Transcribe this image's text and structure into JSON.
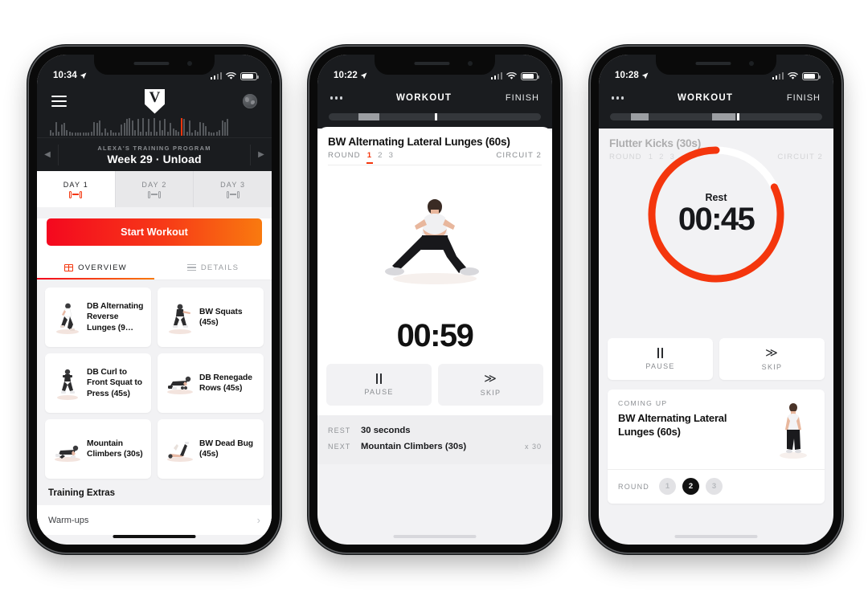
{
  "phone1": {
    "status": {
      "time": "10:34",
      "location_icon": "location-arrow-icon",
      "signal": "signal-icon",
      "wifi": "wifi-icon",
      "battery": "battery-icon"
    },
    "nav": {
      "menu_icon": "hamburger-menu-icon",
      "logo": "V",
      "logo_icon": "shield-logo-icon",
      "account_icon": "globe-icon"
    },
    "activity_bars": [
      3,
      1,
      9,
      2,
      7,
      8,
      3,
      2,
      1,
      1,
      1,
      1,
      1,
      1,
      1,
      2,
      9,
      8,
      10,
      1,
      4,
      1,
      3,
      1,
      1,
      1,
      7,
      8,
      11,
      12,
      10,
      3,
      11,
      2,
      12,
      2,
      11,
      2,
      12,
      2,
      10,
      3,
      11,
      2,
      8,
      4,
      3,
      2,
      12,
      11,
      2,
      10,
      1,
      3,
      2,
      9,
      8,
      6,
      2,
      1,
      1,
      2,
      3,
      10,
      9,
      11
    ],
    "activity_hot_index": 48,
    "program": {
      "prev_icon": "chevron-left-icon",
      "next_icon": "chevron-right-icon",
      "subtitle": "ALEXA'S TRAINING PROGRAM",
      "title": "Week 29 · Unload"
    },
    "day_tabs": [
      {
        "label": "DAY 1",
        "icon": "dumbbell-icon",
        "active": true
      },
      {
        "label": "DAY 2",
        "icon": "dumbbell-icon",
        "active": false
      },
      {
        "label": "DAY 3",
        "icon": "dumbbell-icon",
        "active": false
      }
    ],
    "start_button": "Start Workout",
    "view_tabs": [
      {
        "label": "OVERVIEW",
        "icon": "grid-icon",
        "active": true
      },
      {
        "label": "DETAILS",
        "icon": "list-icon",
        "active": false
      }
    ],
    "exercises": [
      {
        "name": "DB Alternating Reverse Lunges (9…",
        "thumb": "exercise-thumbnail"
      },
      {
        "name": "BW Squats (45s)",
        "thumb": "exercise-thumbnail"
      },
      {
        "name": "DB Curl to Front Squat to Press (45s)",
        "thumb": "exercise-thumbnail"
      },
      {
        "name": "DB Renegade Rows (45s)",
        "thumb": "exercise-thumbnail"
      },
      {
        "name": "Mountain Climbers (30s)",
        "thumb": "exercise-thumbnail"
      },
      {
        "name": "BW Dead Bug (45s)",
        "thumb": "exercise-thumbnail"
      }
    ],
    "extras_heading": "Training Extras",
    "extras_items": [
      {
        "label": "Warm-ups",
        "chevron": "chevron-right-icon"
      }
    ]
  },
  "phone2": {
    "status": {
      "time": "10:22",
      "location_icon": "location-arrow-icon"
    },
    "nav": {
      "more_icon": "more-dots-icon",
      "title": "WORKOUT",
      "finish": "FINISH"
    },
    "progress": {
      "segment_start_pct": 14,
      "segment_width_pct": 10,
      "tick_pct": 50
    },
    "exercise_title": "BW Alternating Lateral Lunges (60s)",
    "round_label": "ROUND",
    "rounds": [
      "1",
      "2",
      "3"
    ],
    "active_round": "1",
    "circuit": "CIRCUIT 2",
    "hero_image": "exercise-photo-lateral-lunge",
    "timer": "00:59",
    "controls": [
      {
        "label": "PAUSE",
        "icon": "pause-icon"
      },
      {
        "label": "SKIP",
        "icon": "skip-forward-icon"
      }
    ],
    "info": [
      {
        "key": "REST",
        "value": "30 seconds",
        "extra": ""
      },
      {
        "key": "NEXT",
        "value": "Mountain Climbers (30s)",
        "extra": "x 30"
      }
    ]
  },
  "phone3": {
    "status": {
      "time": "10:28",
      "location_icon": "location-arrow-icon"
    },
    "nav": {
      "more_icon": "more-dots-icon",
      "title": "WORKOUT",
      "finish": "FINISH"
    },
    "progress": {
      "seg1_start_pct": 10,
      "seg1_width_pct": 8,
      "seg2_start_pct": 48,
      "seg2_width_pct": 11,
      "tick_pct": 60
    },
    "ghost_title": "Flutter Kicks (30s)",
    "ghost_round_label": "ROUND",
    "ghost_rounds": [
      "1",
      "2",
      "3"
    ],
    "ghost_circuit": "CIRCUIT 2",
    "rest_label": "Rest",
    "rest_time": "00:45",
    "ring": {
      "progress_pct": 82,
      "track_color": "#ffffff",
      "arc_color": "#f4360d"
    },
    "controls": [
      {
        "label": "PAUSE",
        "icon": "pause-icon"
      },
      {
        "label": "SKIP",
        "icon": "skip-forward-icon"
      }
    ],
    "coming_up_label": "COMING UP",
    "coming_up_title": "BW Alternating Lateral Lunges (60s)",
    "coming_up_thumb": "exercise-thumbnail-standing",
    "round_label": "ROUND",
    "round_pills": [
      "1",
      "2",
      "3"
    ],
    "active_pill": "2"
  },
  "colors": {
    "accent_red": "#f4360d",
    "gradient_start": "#f4081f",
    "gradient_end": "#f97a0f",
    "dark": "#1a1c1f",
    "page_bg": "#f2f2f4"
  }
}
